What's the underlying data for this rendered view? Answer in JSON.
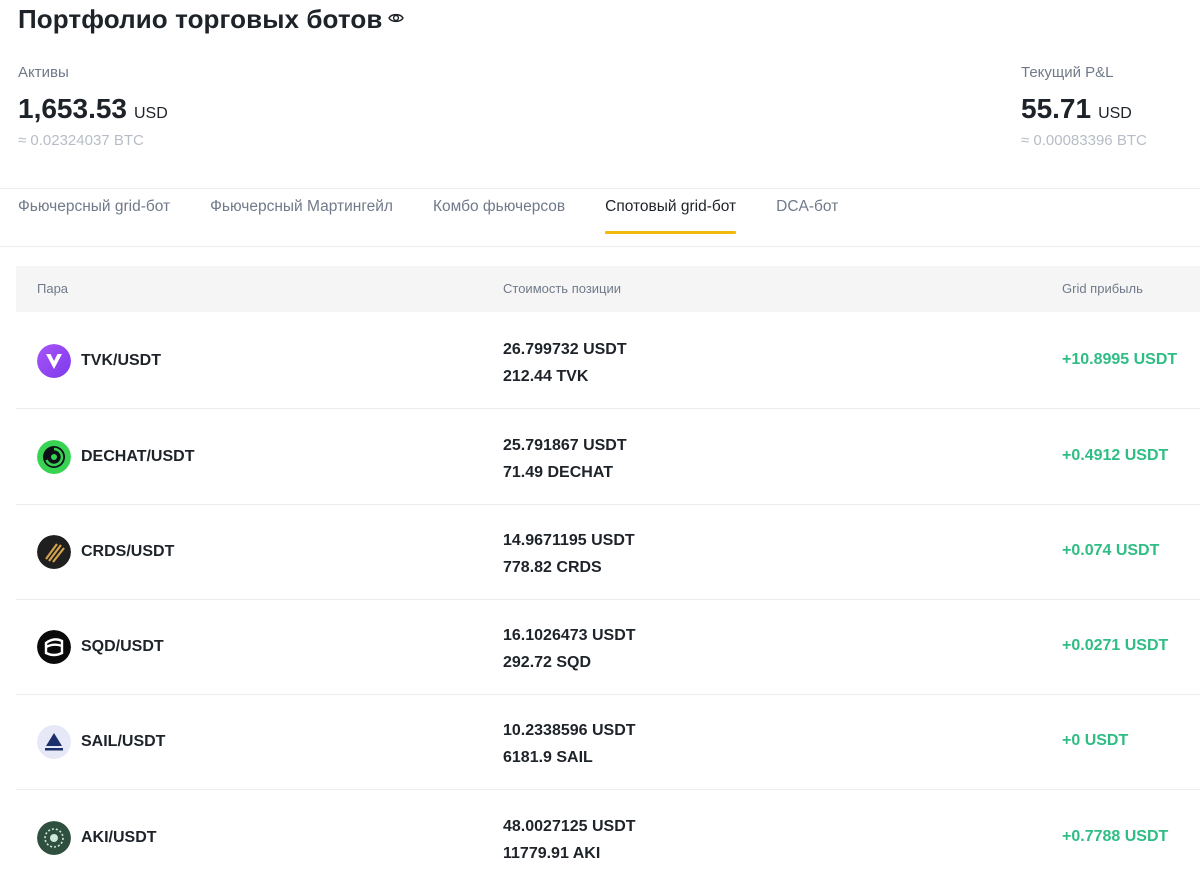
{
  "header": {
    "title": "Портфолио торговых ботов"
  },
  "assets": {
    "label": "Активы",
    "value": "1,653.53",
    "currency": "USD",
    "approx": "≈ 0.02324037 BTC"
  },
  "pnl": {
    "label": "Текущий P&L",
    "value": "55.71",
    "currency": "USD",
    "approx": "≈ 0.00083396 BTC"
  },
  "tabs": [
    {
      "label": "Фьючерсный grid-бот",
      "active": false
    },
    {
      "label": "Фьючерсный Мартингейл",
      "active": false
    },
    {
      "label": "Комбо фьючерсов",
      "active": false
    },
    {
      "label": "Спотовый grid-бот",
      "active": true
    },
    {
      "label": "DCA-бот",
      "active": false
    }
  ],
  "table": {
    "columns": {
      "pair": "Пара",
      "position_value": "Стоимость позиции",
      "grid_profit": "Grid прибыль"
    },
    "rows": [
      {
        "pair": "TVK/USDT",
        "value_usdt": "26.799732 USDT",
        "amount": "212.44 TVK",
        "profit": "+10.8995 USDT",
        "icon": "tvk-icon"
      },
      {
        "pair": "DECHAT/USDT",
        "value_usdt": "25.791867 USDT",
        "amount": "71.49 DECHAT",
        "profit": "+0.4912 USDT",
        "icon": "dechat-icon"
      },
      {
        "pair": "CRDS/USDT",
        "value_usdt": "14.9671195 USDT",
        "amount": "778.82 CRDS",
        "profit": "+0.074 USDT",
        "icon": "crds-icon"
      },
      {
        "pair": "SQD/USDT",
        "value_usdt": "16.1026473 USDT",
        "amount": "292.72 SQD",
        "profit": "+0.0271 USDT",
        "icon": "sqd-icon"
      },
      {
        "pair": "SAIL/USDT",
        "value_usdt": "10.2338596 USDT",
        "amount": "6181.9 SAIL",
        "profit": "+0 USDT",
        "icon": "sail-icon"
      },
      {
        "pair": "AKI/USDT",
        "value_usdt": "48.0027125 USDT",
        "amount": "11779.91 AKI",
        "profit": "+0.7788 USDT",
        "icon": "aki-icon"
      }
    ]
  },
  "colors": {
    "profit": "#2ebd85",
    "tab_underline": "#f0b90b",
    "muted": "#707a8a"
  }
}
